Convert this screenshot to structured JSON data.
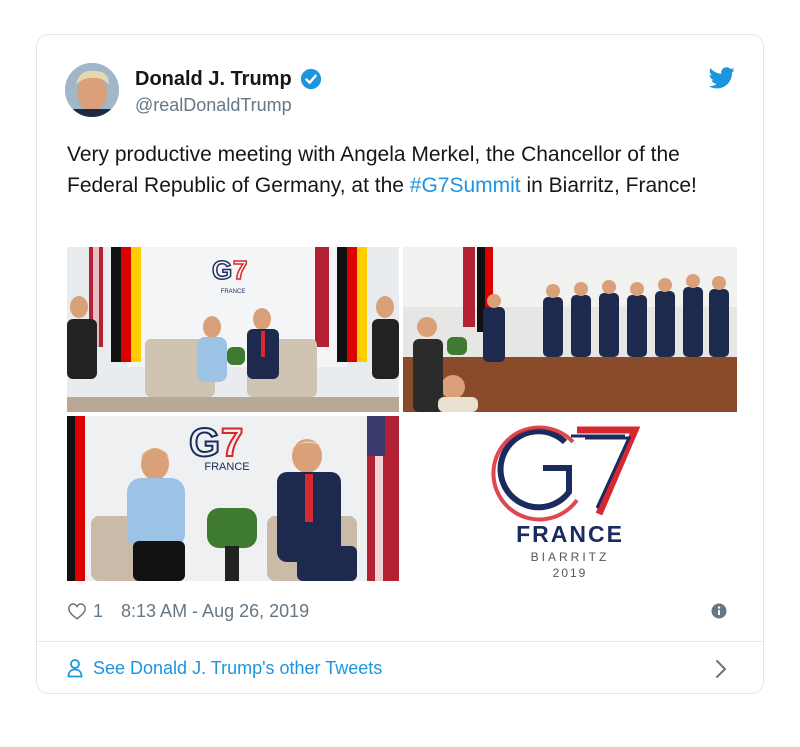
{
  "user": {
    "display_name": "Donald J. Trump",
    "handle": "@realDonaldTrump"
  },
  "tweet": {
    "text_before": "Very productive meeting with Angela Merkel, the Chancellor of the Federal Republic of Germany, at the ",
    "hashtag": "#G7Summit",
    "text_after": " in Biarritz, France!"
  },
  "media": {
    "logo": {
      "line1": "FRANCE",
      "line2": "BIARRITZ",
      "line3": "2019"
    },
    "photo_logo_text": "FRANCE"
  },
  "meta": {
    "likes": "1",
    "timestamp": "8:13 AM - Aug 26, 2019"
  },
  "footer": {
    "link_label": "See Donald J. Trump's other Tweets"
  },
  "colors": {
    "link_blue": "#1b95e0",
    "g7_red": "#d8282f",
    "g7_navy": "#1c2b5e"
  },
  "icons": [
    "verified-badge-icon",
    "twitter-bird-icon",
    "heart-icon",
    "info-icon",
    "person-icon",
    "chevron-right-icon"
  ]
}
